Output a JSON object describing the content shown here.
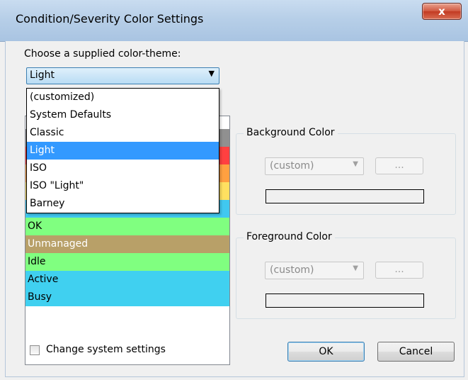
{
  "window": {
    "title": "Condition/Severity Color Settings",
    "close_glyph": "x"
  },
  "theme": {
    "label": "Choose a supplied color-theme:",
    "selected": "Light",
    "arrow": "▼",
    "options": [
      "(customized)",
      "System Defaults",
      "Classic",
      "Light",
      "ISO",
      "ISO \"Light\"",
      "Barney"
    ],
    "selected_index": 3
  },
  "conditions": {
    "items": [
      {
        "label": "",
        "bg": "#909090",
        "fg": "#000000"
      },
      {
        "label": "",
        "bg": "#ff4040",
        "fg": "#000000"
      },
      {
        "label": "",
        "bg": "#ffa040",
        "fg": "#000000"
      },
      {
        "label": "",
        "bg": "#ffe060",
        "fg": "#000000"
      },
      {
        "label": "",
        "bg": "#40c8f0",
        "fg": "#000000"
      },
      {
        "label": "OK",
        "bg": "#80ff80",
        "fg": "#000000"
      },
      {
        "label": "Unmanaged",
        "bg": "#b8a068",
        "fg": "#ffffff"
      },
      {
        "label": "Idle",
        "bg": "#80ff80",
        "fg": "#000000"
      },
      {
        "label": "Active",
        "bg": "#40d0f0",
        "fg": "#000000"
      },
      {
        "label": "Busy",
        "bg": "#40d0f0",
        "fg": "#000000"
      }
    ]
  },
  "background": {
    "title": "Background Color",
    "combo_value": "(custom)",
    "arrow": "▼",
    "button_label": "..."
  },
  "foreground": {
    "title": "Foreground Color",
    "combo_value": "(custom)",
    "arrow": "▼",
    "button_label": "..."
  },
  "footer": {
    "checkbox_label": "Change system settings",
    "checkbox_checked": false,
    "ok_label": "OK",
    "cancel_label": "Cancel"
  }
}
